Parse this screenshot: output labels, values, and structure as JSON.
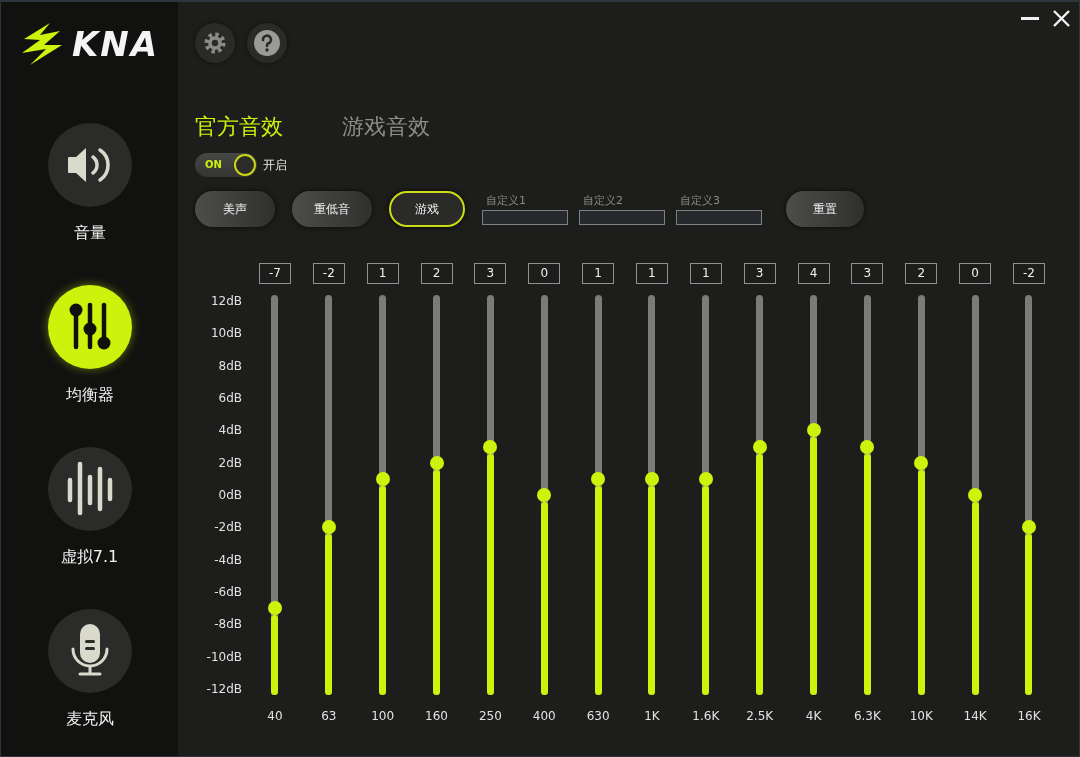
{
  "window": {
    "controls": [
      {
        "kind": "minimize"
      },
      {
        "kind": "close"
      }
    ]
  },
  "logo": {
    "text": "KNA"
  },
  "sidebar": {
    "items": [
      {
        "kind": "volume",
        "label": "音量",
        "selected": false
      },
      {
        "kind": "equalizer",
        "label": "均衡器",
        "selected": true
      },
      {
        "kind": "surround",
        "label": "虚拟7.1",
        "selected": false
      },
      {
        "kind": "microphone",
        "label": "麦克风",
        "selected": false
      }
    ]
  },
  "toolbar": {
    "buttons": [
      {
        "kind": "settings"
      },
      {
        "kind": "help"
      }
    ]
  },
  "tabs": [
    {
      "label": "官方音效",
      "selected": true
    },
    {
      "label": "游戏音效",
      "selected": false
    }
  ],
  "power_toggle": {
    "on": true,
    "state_text": "ON",
    "label": "开启"
  },
  "presets": [
    {
      "kind": "button",
      "label": "美声",
      "selected": false
    },
    {
      "kind": "button",
      "label": "重低音",
      "selected": false
    },
    {
      "kind": "button",
      "label": "游戏",
      "selected": true
    },
    {
      "kind": "custom",
      "label": "自定义1",
      "selected": false
    },
    {
      "kind": "custom",
      "label": "自定义2",
      "selected": false
    },
    {
      "kind": "custom",
      "label": "自定义3",
      "selected": false
    }
  ],
  "reset_button": {
    "label": "重置"
  },
  "equalizer": {
    "scale": [
      "12dB",
      "10dB",
      "8dB",
      "6dB",
      "4dB",
      "2dB",
      "0dB",
      "-2dB",
      "-4dB",
      "-6dB",
      "-8dB",
      "-10dB",
      "-12dB"
    ],
    "bands": [
      {
        "reading": "-7",
        "level": 0.208,
        "frequency": "40"
      },
      {
        "reading": "-2",
        "level": 0.417,
        "frequency": "63"
      },
      {
        "reading": "1",
        "level": 0.542,
        "frequency": "100"
      },
      {
        "reading": "2",
        "level": 0.583,
        "frequency": "160"
      },
      {
        "reading": "3",
        "level": 0.625,
        "frequency": "250"
      },
      {
        "reading": "0",
        "level": 0.5,
        "frequency": "400"
      },
      {
        "reading": "1",
        "level": 0.542,
        "frequency": "630"
      },
      {
        "reading": "1",
        "level": 0.542,
        "frequency": "1K"
      },
      {
        "reading": "1",
        "level": 0.542,
        "frequency": "1.6K"
      },
      {
        "reading": "3",
        "level": 0.625,
        "frequency": "2.5K"
      },
      {
        "reading": "4",
        "level": 0.667,
        "frequency": "4K"
      },
      {
        "reading": "3",
        "level": 0.625,
        "frequency": "6.3K"
      },
      {
        "reading": "2",
        "level": 0.583,
        "frequency": "10K"
      },
      {
        "reading": "0",
        "level": 0.5,
        "frequency": "14K"
      },
      {
        "reading": "-2",
        "level": 0.417,
        "frequency": "16K"
      }
    ]
  }
}
